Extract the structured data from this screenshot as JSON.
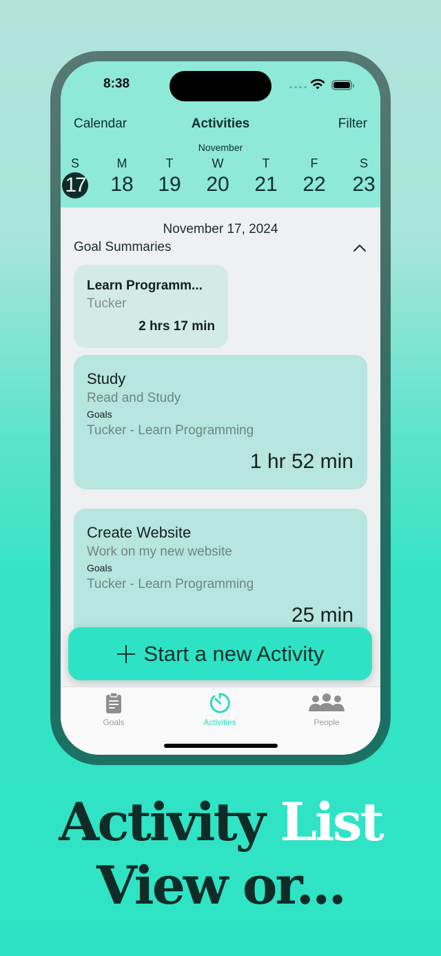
{
  "status_bar": {
    "time": "8:38"
  },
  "nav": {
    "left": "Calendar",
    "title": "Activities",
    "right": "Filter"
  },
  "calendar": {
    "month": "November",
    "days": [
      {
        "dow": "S",
        "num": "17",
        "selected": true
      },
      {
        "dow": "M",
        "num": "18"
      },
      {
        "dow": "T",
        "num": "19"
      },
      {
        "dow": "W",
        "num": "20"
      },
      {
        "dow": "T",
        "num": "21"
      },
      {
        "dow": "F",
        "num": "22"
      },
      {
        "dow": "S",
        "num": "23"
      }
    ]
  },
  "main": {
    "date_label": "November 17, 2024",
    "section_title": "Goal Summaries",
    "goal_summaries": [
      {
        "title": "Learn Programm...",
        "owner": "Tucker",
        "total": "2 hrs 17 min"
      }
    ],
    "activities": [
      {
        "title": "Study",
        "description": "Read and Study",
        "goals_label": "Goals",
        "goal": "Tucker - Learn Programming",
        "duration": "1 hr 52 min"
      },
      {
        "title": "Create Website",
        "description": "Work on my new website",
        "goals_label": "Goals",
        "goal": "Tucker - Learn Programming",
        "duration": "25 min"
      }
    ],
    "start_button": "Start a new Activity"
  },
  "tabbar": {
    "tabs": [
      {
        "label": "Goals",
        "icon": "clipboard-icon"
      },
      {
        "label": "Activities",
        "icon": "timer-icon",
        "active": true
      },
      {
        "label": "People",
        "icon": "people-icon"
      }
    ]
  },
  "headline": {
    "line1_dark": "Activity",
    "line1_light": "List",
    "line2": "View or..."
  },
  "colors": {
    "accent": "#2ee3c5",
    "header_bg": "#8ee9d9",
    "card_bg": "#b7e5df",
    "dark_text": "#0f2c27"
  }
}
